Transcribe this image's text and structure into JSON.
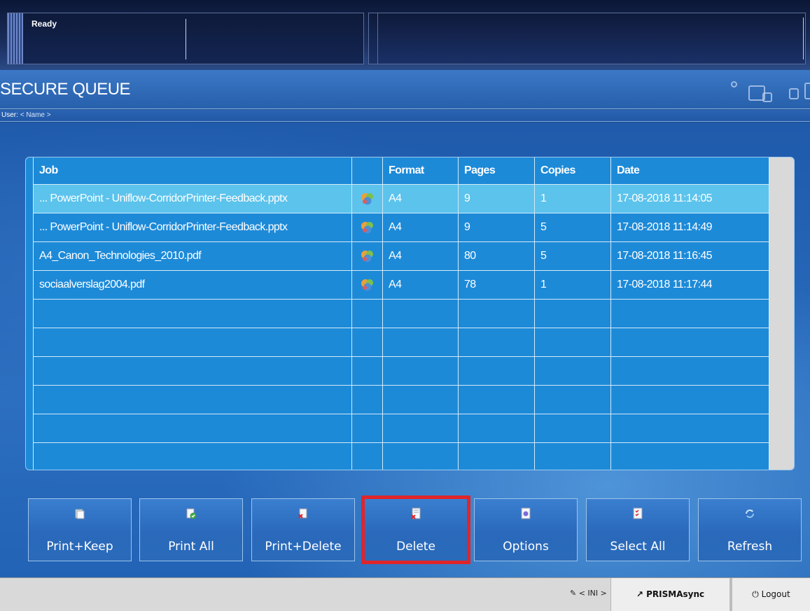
{
  "status": {
    "text": "Ready"
  },
  "header": {
    "title": "SECURE QUEUE"
  },
  "user": {
    "label": "User:",
    "name": "< Name >"
  },
  "table": {
    "columns": [
      "Job",
      "",
      "Format",
      "Pages",
      "Copies",
      "Date"
    ],
    "rows": [
      {
        "job": "... PowerPoint - Uniflow-CorridorPrinter-Feedback.pptx",
        "icon": "document-icon",
        "format": "A4",
        "pages": "9",
        "copies": "1",
        "date": "17-08-2018 11:14:05",
        "selected": true
      },
      {
        "job": "... PowerPoint - Uniflow-CorridorPrinter-Feedback.pptx",
        "icon": "document-icon",
        "format": "A4",
        "pages": "9",
        "copies": "5",
        "date": "17-08-2018 11:14:49",
        "selected": false
      },
      {
        "job": "A4_Canon_Technologies_2010.pdf",
        "icon": "document-icon",
        "format": "A4",
        "pages": "80",
        "copies": "5",
        "date": "17-08-2018 11:16:45",
        "selected": false
      },
      {
        "job": "sociaalverslag2004.pdf",
        "icon": "document-icon",
        "format": "A4",
        "pages": "78",
        "copies": "1",
        "date": "17-08-2018 11:17:44",
        "selected": false
      }
    ],
    "empty_rows": 6
  },
  "buttons": [
    {
      "label": "Print+Keep",
      "icon": "print-keep-icon"
    },
    {
      "label": "Print All",
      "icon": "print-all-icon"
    },
    {
      "label": "Print+Delete",
      "icon": "print-delete-icon"
    },
    {
      "label": "Delete",
      "icon": "delete-icon",
      "highlighted": true
    },
    {
      "label": "Options",
      "icon": "options-icon"
    },
    {
      "label": "Select All",
      "icon": "select-all-icon"
    },
    {
      "label": "Refresh",
      "icon": "refresh-icon"
    }
  ],
  "footer": {
    "ini": "< INI >",
    "prisma": "PRISMAsync",
    "logout": "Logout"
  },
  "colors": {
    "row": "#1d8ad8",
    "selected_row": "#5cc3ec",
    "highlight": "#e0252a"
  }
}
